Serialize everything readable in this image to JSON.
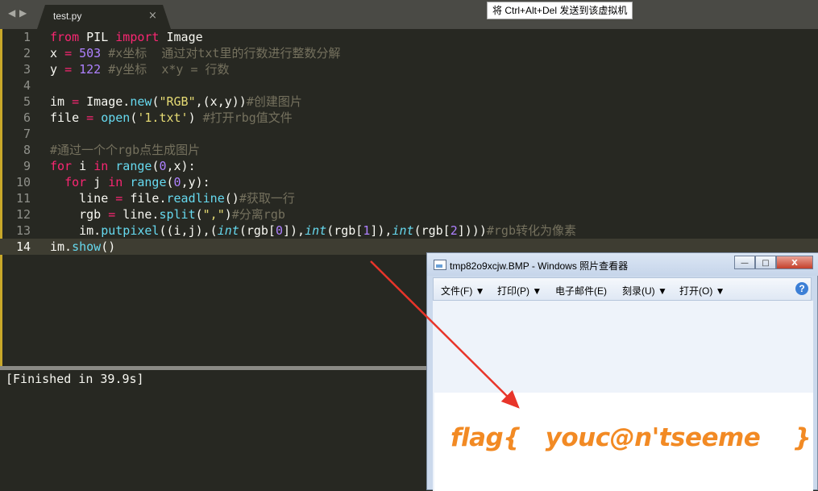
{
  "tab": {
    "arrow_left": "◀",
    "arrow_right": "▶",
    "filename": "test.py",
    "close": "×"
  },
  "hint": "将 Ctrl+Alt+Del 发送到该虚拟机",
  "code_lines": [
    {
      "n": "1",
      "html": "<span class=\"kw\">from</span> PIL <span class=\"kw\">import</span> Image"
    },
    {
      "n": "2",
      "html": "x <span class=\"kw\">=</span> <span class=\"num\">503</span> <span class=\"cm\">#x坐标  通过对txt里的行数进行整数分解</span>"
    },
    {
      "n": "3",
      "html": "y <span class=\"kw\">=</span> <span class=\"num\">122</span> <span class=\"cm\">#y坐标  x*y = 行数</span>"
    },
    {
      "n": "4",
      "html": ""
    },
    {
      "n": "5",
      "html": "im <span class=\"kw\">=</span> Image.<span class=\"fn\">new</span>(<span class=\"str\">\"RGB\"</span>,(x,y))<span class=\"cm\">#创建图片</span>"
    },
    {
      "n": "6",
      "html": "file <span class=\"kw\">=</span> <span class=\"fn\">open</span>(<span class=\"str\">'1.txt'</span>) <span class=\"cm\">#打开rbg值文件</span>"
    },
    {
      "n": "7",
      "html": ""
    },
    {
      "n": "8",
      "html": "<span class=\"cm\">#通过一个个rgb点生成图片</span>"
    },
    {
      "n": "9",
      "html": "<span class=\"kw\">for</span> i <span class=\"kw\">in</span> <span class=\"fn\">range</span>(<span class=\"num\">0</span>,x):"
    },
    {
      "n": "10",
      "html": "  <span class=\"kw\">for</span> j <span class=\"kw\">in</span> <span class=\"fn\">range</span>(<span class=\"num\">0</span>,y):"
    },
    {
      "n": "11",
      "html": "    line <span class=\"kw\">=</span> file.<span class=\"fn\">readline</span>()<span class=\"cm\">#获取一行</span>"
    },
    {
      "n": "12",
      "html": "    rgb <span class=\"kw\">=</span> line.<span class=\"fn\">split</span>(<span class=\"str\">\",\"</span>)<span class=\"cm\">#分离rgb</span>"
    },
    {
      "n": "13",
      "html": "    im.<span class=\"fn\">putpixel</span>((i,j),(<span class=\"it\">int</span>(rgb[<span class=\"num\">0</span>]),<span class=\"it\">int</span>(rgb[<span class=\"num\">1</span>]),<span class=\"it\">int</span>(rgb[<span class=\"num\">2</span>])))<span class=\"cm\">#rgb转化为像素</span>"
    },
    {
      "n": "14",
      "html": "im.<span class=\"fn\">show</span>()"
    }
  ],
  "console": "[Finished in 39.9s]",
  "viewer": {
    "title": "tmp82o9xcjw.BMP - Windows 照片查看器",
    "buttons": {
      "minimize": "—",
      "maximize": "□",
      "close": "X"
    },
    "menu": [
      {
        "label": "文件(F)",
        "arrow": "▼"
      },
      {
        "label": "打印(P)",
        "arrow": "▼"
      },
      {
        "label": "电子邮件(E)",
        "arrow": ""
      },
      {
        "label": "刻录(U)",
        "arrow": "▼"
      },
      {
        "label": "打开(O)",
        "arrow": "▼"
      }
    ],
    "help": "?",
    "flag_text": "flag{   youc@n'tseeme    }"
  },
  "colors": {
    "editor_bg": "#272822",
    "keyword": "#f92672",
    "function": "#66d9ef",
    "number": "#ae81ff",
    "string": "#e6db74",
    "comment": "#75715e",
    "flag_orange": "#f28a24",
    "arrow_red": "#e8352a"
  }
}
